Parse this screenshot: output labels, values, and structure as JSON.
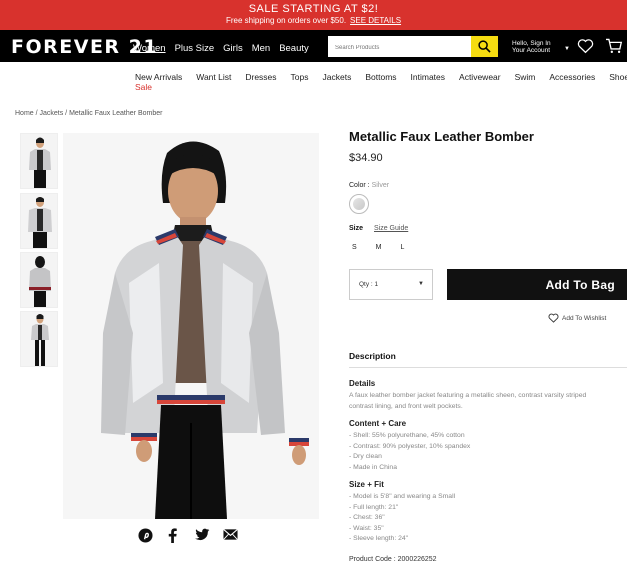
{
  "promo": {
    "title": "SALE STARTING AT $2!",
    "subtitle": "Free shipping on orders over $50.",
    "link": "SEE DETAILS"
  },
  "header": {
    "logo": "FOREVER 21",
    "nav": [
      "Women",
      "Plus Size",
      "Girls",
      "Men",
      "Beauty"
    ],
    "search_placeholder": "Search Products",
    "account_line1": "Hello, Sign In",
    "account_line2": "Your Account"
  },
  "categories": [
    "New Arrivals",
    "Want List",
    "Dresses",
    "Tops",
    "Jackets",
    "Bottoms",
    "Intimates",
    "Activewear",
    "Swim",
    "Accessories",
    "Shoes"
  ],
  "sale_label": "Sale",
  "breadcrumb": "Home / Jackets / Metallic Faux Leather Bomber",
  "product": {
    "title": "Metallic Faux Leather Bomber",
    "price": "$34.90",
    "color_label": "Color",
    "color_value": "Silver",
    "size_label": "Size",
    "size_guide": "Size Guide",
    "sizes": [
      "S",
      "M",
      "L"
    ],
    "qty": "Qty : 1",
    "add_to_bag": "Add To Bag",
    "wishlist": "Add To Wishlist",
    "description_heading": "Description",
    "details_heading": "Details",
    "details_text": [
      "A faux leather bomber jacket featuring a metallic sheen, contrast varsity striped",
      "contrast lining, and front welt pockets."
    ],
    "content_heading": "Content + Care",
    "content_text": [
      "- Shell: 55% polyurethane, 45% cotton",
      "- Contrast: 90% polyester, 10% spandex",
      "- Dry clean",
      "- Made in China"
    ],
    "fit_heading": "Size + Fit",
    "fit_text": [
      "- Model is 5'8\" and wearing a Small",
      "- Full length: 21\"",
      "- Chest: 36\"",
      "- Waist: 35\"",
      "- Sleeve length: 24\""
    ],
    "product_code": "Product Code : 2000226252"
  },
  "colors": {
    "promo": "#d8322d",
    "search_button": "#f5dc11",
    "add_to_bag": "#111111"
  },
  "icons": [
    "search-icon",
    "heart-icon",
    "bag-icon",
    "pinterest-icon",
    "facebook-icon",
    "twitter-icon",
    "email-icon"
  ]
}
